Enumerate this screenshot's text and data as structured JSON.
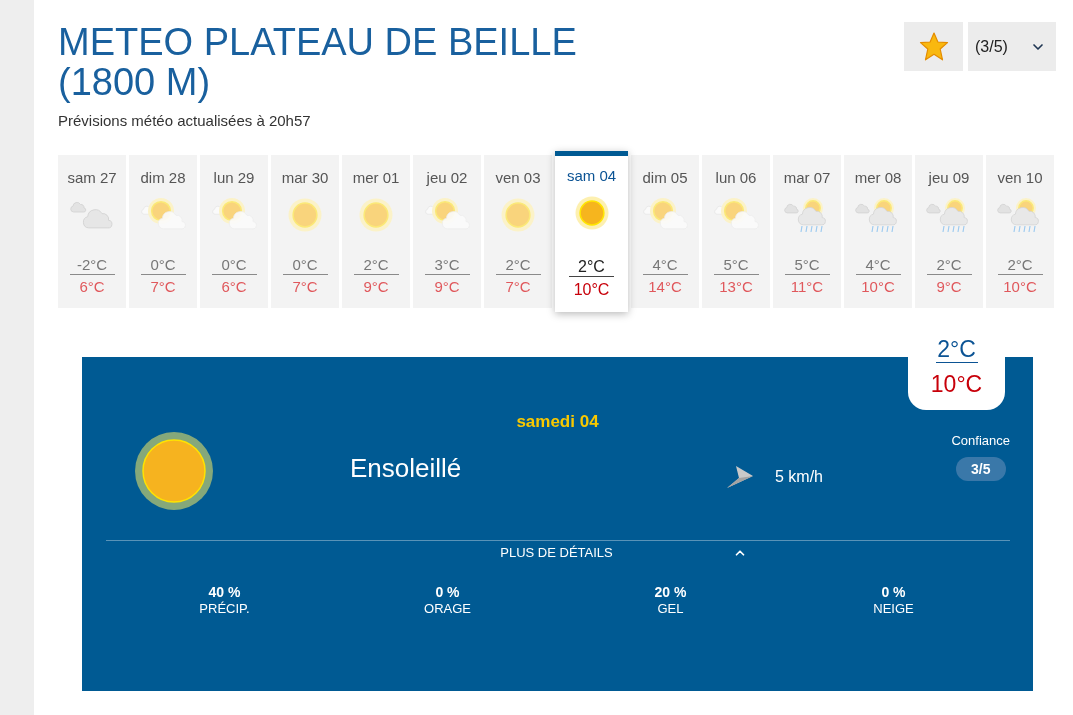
{
  "header": {
    "title": "METEO PLATEAU DE BEILLE (1800 M)",
    "subtitle": "Prévisions météo actualisées à 20h57",
    "rating_dropdown": {
      "value": "(3/5)"
    }
  },
  "days": [
    {
      "label": "sam 27",
      "kind": "cloudy",
      "min": "-2°C",
      "max": "6°C",
      "selected": false
    },
    {
      "label": "dim 28",
      "kind": "suncloud",
      "min": "0°C",
      "max": "7°C",
      "selected": false
    },
    {
      "label": "lun 29",
      "kind": "suncloud",
      "min": "0°C",
      "max": "6°C",
      "selected": false
    },
    {
      "label": "mar 30",
      "kind": "sunny",
      "min": "0°C",
      "max": "7°C",
      "selected": false
    },
    {
      "label": "mer 01",
      "kind": "sunny",
      "min": "2°C",
      "max": "9°C",
      "selected": false
    },
    {
      "label": "jeu 02",
      "kind": "suncloud",
      "min": "3°C",
      "max": "9°C",
      "selected": false
    },
    {
      "label": "ven 03",
      "kind": "sunny",
      "min": "2°C",
      "max": "7°C",
      "selected": false
    },
    {
      "label": "sam 04",
      "kind": "sunny",
      "min": "2°C",
      "max": "10°C",
      "selected": true
    },
    {
      "label": "dim 05",
      "kind": "suncloud",
      "min": "4°C",
      "max": "14°C",
      "selected": false
    },
    {
      "label": "lun 06",
      "kind": "suncloud",
      "min": "5°C",
      "max": "13°C",
      "selected": false
    },
    {
      "label": "mar 07",
      "kind": "rain",
      "min": "5°C",
      "max": "11°C",
      "selected": false
    },
    {
      "label": "mer 08",
      "kind": "rain",
      "min": "4°C",
      "max": "10°C",
      "selected": false
    },
    {
      "label": "jeu 09",
      "kind": "rain",
      "min": "2°C",
      "max": "9°C",
      "selected": false
    },
    {
      "label": "ven 10",
      "kind": "rain",
      "min": "2°C",
      "max": "10°C",
      "selected": false
    }
  ],
  "detail": {
    "temperature": {
      "min": "2°C",
      "max": "10°C"
    },
    "date": "samedi 04",
    "kind": "sunny",
    "condition": "Ensoleillé",
    "wind": "5 km/h",
    "confidence": {
      "label": "Confiance",
      "value": "3/5"
    },
    "details_toggle": {
      "label": "PLUS DE DÉTAILS",
      "expanded": true
    },
    "stats": [
      {
        "value": "40 %",
        "label": "PRÉCIP."
      },
      {
        "value": "0 %",
        "label": "ORAGE"
      },
      {
        "value": "20 %",
        "label": "GEL"
      },
      {
        "value": "0 %",
        "label": "NEIGE"
      }
    ]
  }
}
